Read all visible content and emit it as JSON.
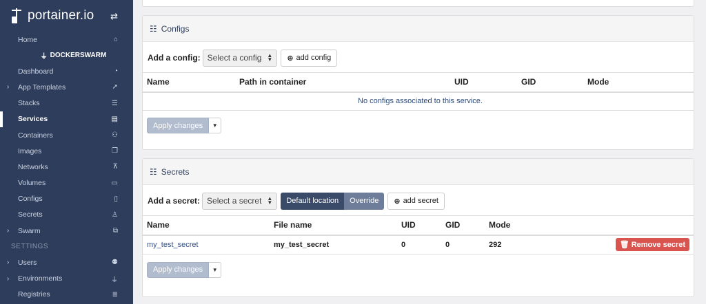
{
  "brand": {
    "name": "portainer.io"
  },
  "sidebar": {
    "home": "Home",
    "environment": "DOCKERSWARM",
    "items": [
      {
        "label": "Dashboard",
        "icon": "tachometer-icon"
      },
      {
        "label": "App Templates",
        "icon": "rocket-icon",
        "expandable": true
      },
      {
        "label": "Stacks",
        "icon": "list-icon"
      },
      {
        "label": "Services",
        "icon": "list-alt-icon",
        "current": true
      },
      {
        "label": "Containers",
        "icon": "cubes-icon"
      },
      {
        "label": "Images",
        "icon": "clone-icon"
      },
      {
        "label": "Networks",
        "icon": "sitemap-icon"
      },
      {
        "label": "Volumes",
        "icon": "hdd-icon"
      },
      {
        "label": "Configs",
        "icon": "file-code-icon"
      },
      {
        "label": "Secrets",
        "icon": "user-secret-icon"
      },
      {
        "label": "Swarm",
        "icon": "object-group-icon",
        "expandable": true
      }
    ],
    "settings_heading": "SETTINGS",
    "settings": [
      {
        "label": "Users",
        "icon": "users-icon",
        "expandable": true
      },
      {
        "label": "Environments",
        "icon": "plug-icon",
        "expandable": true
      },
      {
        "label": "Registries",
        "icon": "database-icon"
      }
    ]
  },
  "configs": {
    "title": "Configs",
    "add_label": "Add a config:",
    "select_placeholder": "Select a config",
    "add_button": "add config",
    "columns": [
      "Name",
      "Path in container",
      "UID",
      "GID",
      "Mode"
    ],
    "empty_message": "No configs associated to this service.",
    "apply_button": "Apply changes"
  },
  "secrets": {
    "title": "Secrets",
    "add_label": "Add a secret:",
    "select_placeholder": "Select a secret",
    "toggle_default": "Default location",
    "toggle_override": "Override",
    "add_button": "add secret",
    "columns": [
      "Name",
      "File name",
      "UID",
      "GID",
      "Mode"
    ],
    "rows": [
      {
        "name": "my_test_secret",
        "file": "my_test_secret",
        "uid": "0",
        "gid": "0",
        "mode": "292"
      }
    ],
    "remove_button": "Remove secret",
    "apply_button": "Apply changes"
  },
  "colors": {
    "sidebar": "#2e3d5c",
    "danger": "#d9534f",
    "link": "#34528a"
  }
}
